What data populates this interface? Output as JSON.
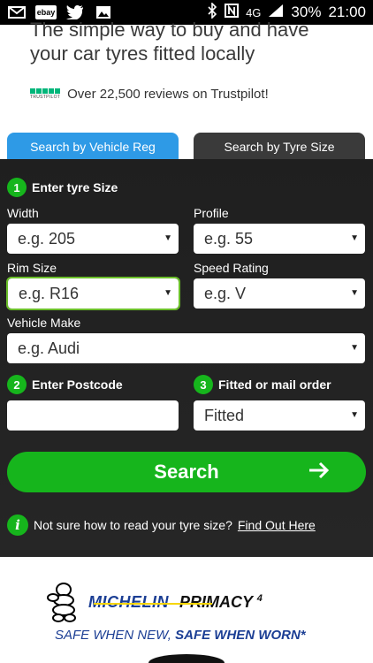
{
  "status_bar": {
    "icons": [
      "gmail-icon",
      "ebay-icon",
      "twitter-icon",
      "image-icon"
    ],
    "ebay_label": "ebay",
    "network": "4G",
    "battery": "30%",
    "time": "21:00"
  },
  "hero": {
    "title_line1": "The simple way to buy and have",
    "title_line2": "your car tyres fitted locally",
    "trustpilot_label": "TRUSTPILOT",
    "reviews_text": "Over 22,500 reviews on Trustpilot!"
  },
  "tabs": [
    {
      "label": "Search by Vehicle Reg"
    },
    {
      "label": "Search by Tyre Size"
    }
  ],
  "form": {
    "step1": {
      "number": "1",
      "label": "Enter tyre Size"
    },
    "width": {
      "label": "Width",
      "value": "e.g. 205"
    },
    "profile": {
      "label": "Profile",
      "value": "e.g. 55"
    },
    "rim": {
      "label": "Rim Size",
      "value": "e.g. R16"
    },
    "speed": {
      "label": "Speed Rating",
      "value": "e.g. V"
    },
    "make": {
      "label": "Vehicle Make",
      "value": "e.g. Audi"
    },
    "step2": {
      "number": "2",
      "label": "Enter Postcode"
    },
    "postcode": {
      "value": "",
      "placeholder": ""
    },
    "step3": {
      "number": "3",
      "label": "Fitted or mail order"
    },
    "fitted": {
      "value": "Fitted"
    },
    "search_label": "Search",
    "help_text": "Not sure how to read your tyre size?",
    "help_link": "Find Out Here"
  },
  "ad": {
    "brand": "MICHELIN",
    "product": "PRIMACY",
    "product_sup": "4",
    "tag_plain": "SAFE WHEN NEW,",
    "tag_bold": "SAFE WHEN WORN*"
  },
  "colors": {
    "accent_green": "#16b51c",
    "tab_blue": "#2e9ae6",
    "michelin_blue": "#1b3e94"
  }
}
